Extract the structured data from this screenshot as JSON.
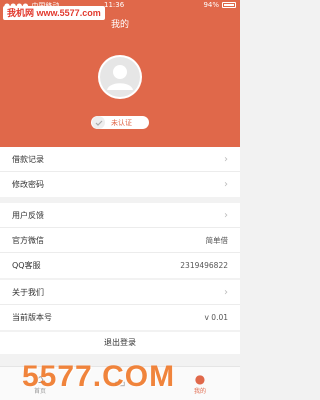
{
  "status_bar": {
    "carrier": "中国移动",
    "time": "11:36",
    "battery": "94%"
  },
  "watermark_top": "我机网 www.5577.com",
  "header": {
    "title": "我的",
    "verify_label": "未认证"
  },
  "groups": [
    {
      "items": [
        {
          "label": "借款记录",
          "chevron": true
        },
        {
          "label": "修改密码",
          "chevron": true
        }
      ]
    },
    {
      "items": [
        {
          "label": "用户反馈",
          "chevron": true
        },
        {
          "label": "官方微信",
          "value": "简单借"
        },
        {
          "label": "QQ客服",
          "value": "2319496822"
        }
      ]
    },
    {
      "items": [
        {
          "label": "关于我们",
          "chevron": true
        },
        {
          "label": "当前版本号",
          "value": "v 0.01"
        }
      ]
    }
  ],
  "logout_label": "退出登录",
  "tabs": [
    {
      "label": "首页",
      "icon": "home-icon"
    },
    {
      "label": "",
      "icon": "loan-icon"
    },
    {
      "label": "我的",
      "icon": "user-icon",
      "active": true
    }
  ],
  "watermark_bottom": "5577.COM",
  "colors": {
    "accent": "#e0684a",
    "background": "#f2f2f2"
  }
}
